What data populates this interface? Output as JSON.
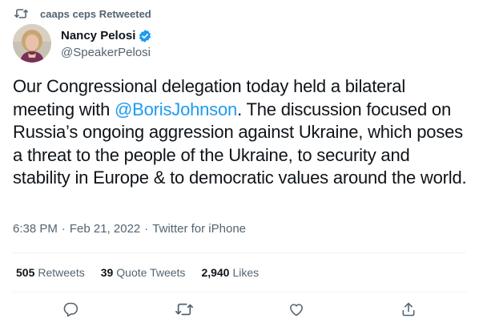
{
  "retweet_banner": {
    "icon": "retweet-icon",
    "text": "caaps ceps Retweeted"
  },
  "author": {
    "name": "Nancy Pelosi",
    "handle": "@SpeakerPelosi",
    "verified": true,
    "avatar": "avatar-photo"
  },
  "tweet": {
    "text_before": "Our Congressional delegation today held a bilateral meeting with ",
    "mention": "@BorisJohnson",
    "text_after": ". The discussion focused on Russia’s ongoing aggression against Ukraine, which poses a threat to the people of the Ukraine, to security and stability in Europe & to democratic values around the world."
  },
  "meta": {
    "time": "6:38 PM",
    "separator": "·",
    "date": "Feb 21, 2022",
    "source": "Twitter for iPhone"
  },
  "stats": {
    "retweets": {
      "count": "505",
      "label": "Retweets"
    },
    "quotes": {
      "count": "39",
      "label": "Quote Tweets"
    },
    "likes": {
      "count": "2,940",
      "label": "Likes"
    }
  },
  "actions": [
    "reply-icon",
    "retweet-icon",
    "like-icon",
    "share-icon"
  ],
  "colors": {
    "text": "#0f1419",
    "secondary": "#536471",
    "link": "#1d9bf0",
    "divider": "#eff3f4"
  }
}
